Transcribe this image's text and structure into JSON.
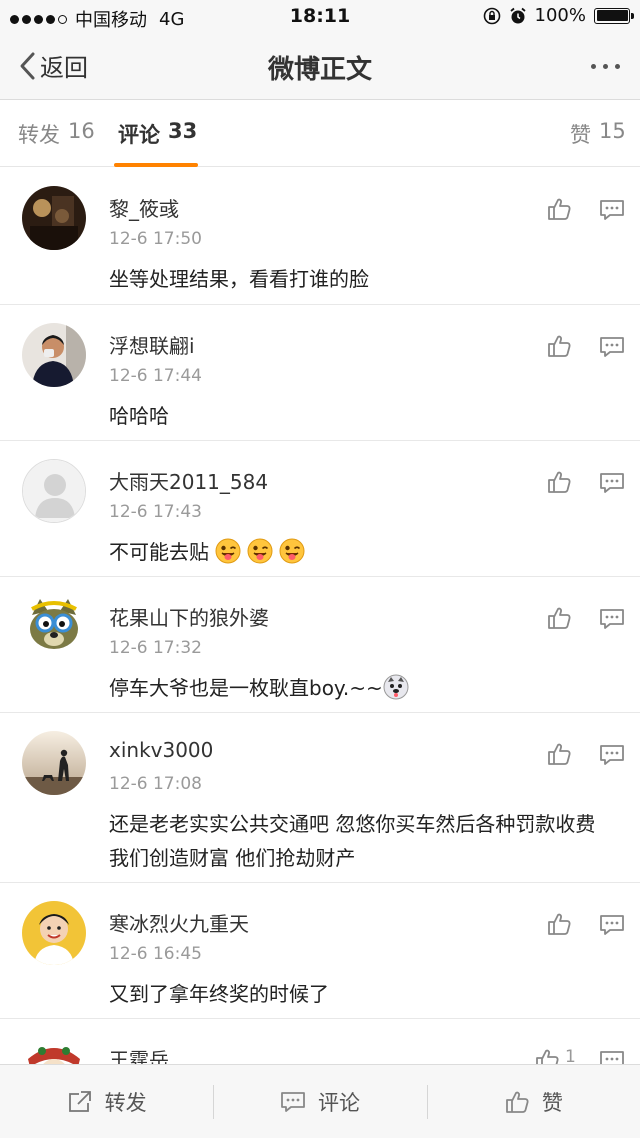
{
  "status_bar": {
    "carrier": "中国移动",
    "network": "4G",
    "time": "18:11",
    "battery": "100%"
  },
  "nav": {
    "back_label": "返回",
    "title": "微博正文"
  },
  "tabs": {
    "repost": {
      "label": "转发",
      "count": "16"
    },
    "comment": {
      "label": "评论",
      "count": "33"
    },
    "like": {
      "label": "赞",
      "count": "15"
    }
  },
  "comments": [
    {
      "user": "黎_筱彧",
      "time": "12-6 17:50",
      "text": "坐等处理结果，看看打谁的脸"
    },
    {
      "user": "浮想联翩i",
      "time": "12-6 17:44",
      "text": "哈哈哈"
    },
    {
      "user": "大雨天2011_584",
      "time": "12-6 17:43",
      "text": "不可能去贴"
    },
    {
      "user": "花果山下的狼外婆",
      "time": "12-6 17:32",
      "text": "停车大爷也是一枚耿直boy.~~"
    },
    {
      "user": "xinkv3000",
      "time": "12-6 17:08",
      "text": "还是老老实实公共交通吧 忽悠你买车然后各种罚款收费 我们创造财富 他们抢劫财产"
    },
    {
      "user": "寒冰烈火九重天",
      "time": "12-6 16:45",
      "text": "又到了拿年终奖的时候了"
    },
    {
      "user": "王霆岳",
      "like_count": "1"
    }
  ],
  "toolbar": {
    "repost_label": "转发",
    "comment_label": "评论",
    "like_label": "赞"
  },
  "colors": {
    "accent": "#ff8200",
    "background": "#f7f7f7",
    "muted_text": "#9a9a9a"
  },
  "icons": [
    "back-chevron-icon",
    "more-dots-icon",
    "like-thumb-icon",
    "reply-comment-icon",
    "share-icon",
    "emoji-tongue-icon",
    "emoji-husky-icon"
  ]
}
